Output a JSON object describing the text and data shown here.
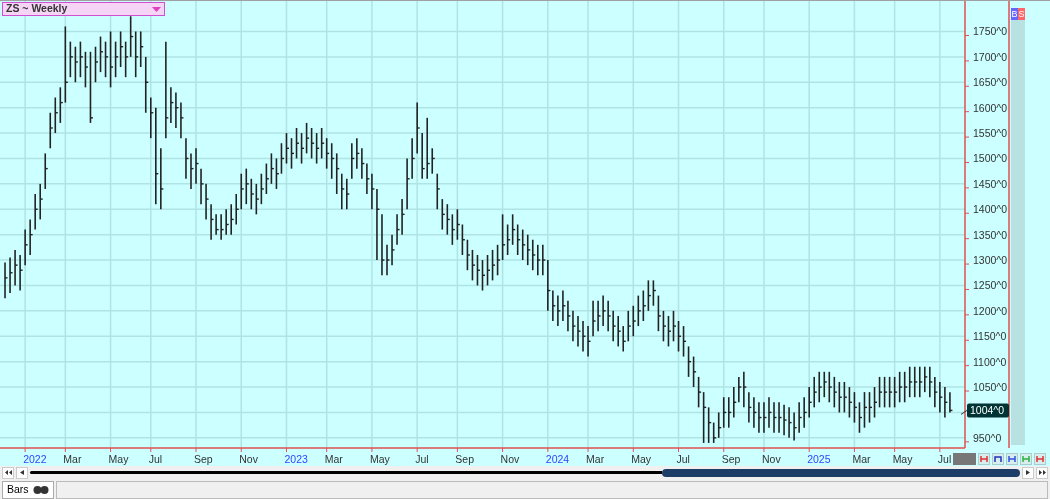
{
  "chart_selector": {
    "label": "ZS ~ Weekly"
  },
  "chart": {
    "y_axis_labels": [
      "1750^0",
      "1700^0",
      "1650^0",
      "1600^0",
      "1550^0",
      "1500^0",
      "1450^0",
      "1400^0",
      "1350^0",
      "1300^0",
      "1250^0",
      "1200^0",
      "1150^0",
      "1100^0",
      "1050^0",
      "950^0"
    ],
    "x_axis_labels": [
      {
        "label": "2022",
        "kind": "year"
      },
      {
        "label": "Mar",
        "kind": "month"
      },
      {
        "label": "May",
        "kind": "month"
      },
      {
        "label": "Jul",
        "kind": "month"
      },
      {
        "label": "Sep",
        "kind": "month"
      },
      {
        "label": "Nov",
        "kind": "month"
      },
      {
        "label": "2023",
        "kind": "year"
      },
      {
        "label": "Mar",
        "kind": "month"
      },
      {
        "label": "May",
        "kind": "month"
      },
      {
        "label": "Jul",
        "kind": "month"
      },
      {
        "label": "Sep",
        "kind": "month"
      },
      {
        "label": "Nov",
        "kind": "month"
      },
      {
        "label": "2024",
        "kind": "year"
      },
      {
        "label": "Mar",
        "kind": "month"
      },
      {
        "label": "May",
        "kind": "month"
      },
      {
        "label": "Jul",
        "kind": "month"
      },
      {
        "label": "Sep",
        "kind": "month"
      },
      {
        "label": "Nov",
        "kind": "month"
      },
      {
        "label": "2025",
        "kind": "year"
      },
      {
        "label": "Mar",
        "kind": "month"
      },
      {
        "label": "May",
        "kind": "month"
      },
      {
        "label": "Jul",
        "kind": "month"
      }
    ],
    "last_price": "1004^0"
  },
  "side_buttons": [
    {
      "label": "B",
      "color": "#6666ff"
    },
    {
      "label": "S",
      "color": "#ff6666"
    }
  ],
  "bottom_tabs": [
    {
      "label": "Bars",
      "selected": true
    }
  ]
}
